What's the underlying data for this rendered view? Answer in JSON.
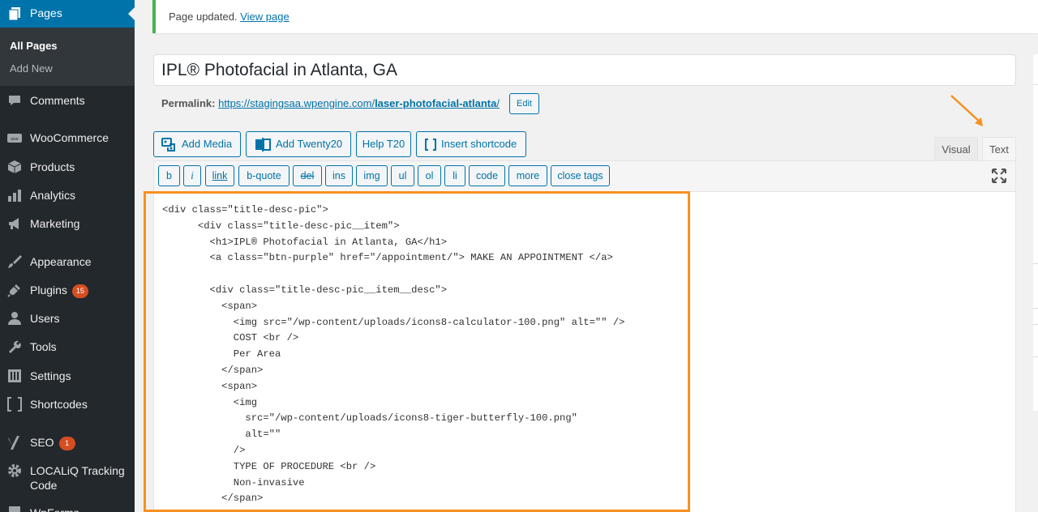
{
  "sidebar": {
    "pages": {
      "label": "Pages",
      "icon": "pages-icon"
    },
    "submenu": {
      "all_pages": "All Pages",
      "add_new": "Add New"
    },
    "items": [
      {
        "key": "comments",
        "label": "Comments",
        "icon": "comments-icon"
      },
      {
        "key": "woocommerce",
        "label": "WooCommerce",
        "icon": "woocommerce-icon"
      },
      {
        "key": "products",
        "label": "Products",
        "icon": "products-icon"
      },
      {
        "key": "analytics",
        "label": "Analytics",
        "icon": "analytics-icon"
      },
      {
        "key": "marketing",
        "label": "Marketing",
        "icon": "megaphone-icon"
      },
      {
        "key": "appearance",
        "label": "Appearance",
        "icon": "paintbrush-icon"
      },
      {
        "key": "plugins",
        "label": "Plugins",
        "icon": "plug-icon",
        "badge": "15"
      },
      {
        "key": "users",
        "label": "Users",
        "icon": "users-icon"
      },
      {
        "key": "tools",
        "label": "Tools",
        "icon": "wrench-icon"
      },
      {
        "key": "settings",
        "label": "Settings",
        "icon": "settings-icon"
      },
      {
        "key": "shortcodes",
        "label": "Shortcodes",
        "icon": "brackets-icon"
      },
      {
        "key": "seo",
        "label": "SEO",
        "icon": "yoast-icon",
        "badge": "1"
      },
      {
        "key": "localiq",
        "label": "LOCALiQ Tracking",
        "label2": "Code",
        "icon": "gear-icon"
      },
      {
        "key": "wpforms",
        "label": "WpForms",
        "icon": "forms-icon"
      }
    ]
  },
  "notice": {
    "text": "Page updated.",
    "link": "View page"
  },
  "title": {
    "value": "IPL® Photofacial in Atlanta, GA"
  },
  "permalink": {
    "label": "Permalink:",
    "url_base": "https://stagingsaa.wpengine.com/",
    "url_slug": "laser-photofacial-atlanta",
    "url_end": "/",
    "edit": "Edit"
  },
  "media_buttons": {
    "add_media": "Add Media",
    "add_twenty20": "Add Twenty20",
    "help_t20": "Help T20",
    "insert_shortcode": "Insert shortcode"
  },
  "tabs": {
    "visual": "Visual",
    "text": "Text",
    "active": "text"
  },
  "quicktags": [
    "b",
    "i",
    "link",
    "b-quote",
    "del",
    "ins",
    "img",
    "ul",
    "ol",
    "li",
    "code",
    "more",
    "close tags"
  ],
  "code_lines": [
    "<div class=\"title-desc-pic\">",
    "      <div class=\"title-desc-pic__item\">",
    "        <h1>IPL® Photofacial in Atlanta, GA</h1>",
    "        <a class=\"btn-purple\" href=\"/appointment/\"> MAKE AN APPOINTMENT </a>",
    "",
    "        <div class=\"title-desc-pic__item__desc\">",
    "          <span>",
    "            <img src=\"/wp-content/uploads/icons8-calculator-100.png\" alt=\"\" />",
    "            COST <br />",
    "            Per Area",
    "          </span>",
    "          <span>",
    "            <img",
    "              src=\"/wp-content/uploads/icons8-tiger-butterfly-100.png\"",
    "              alt=\"\"",
    "            />",
    "            TYPE OF PROCEDURE <br />",
    "            Non-invasive",
    "          </span>"
  ],
  "colors": {
    "sidebar_bg": "#23282d",
    "sidebar_active": "#0073aa",
    "accent": "#0073aa",
    "notice_border": "#46b450",
    "annotation": "#f7911f"
  }
}
